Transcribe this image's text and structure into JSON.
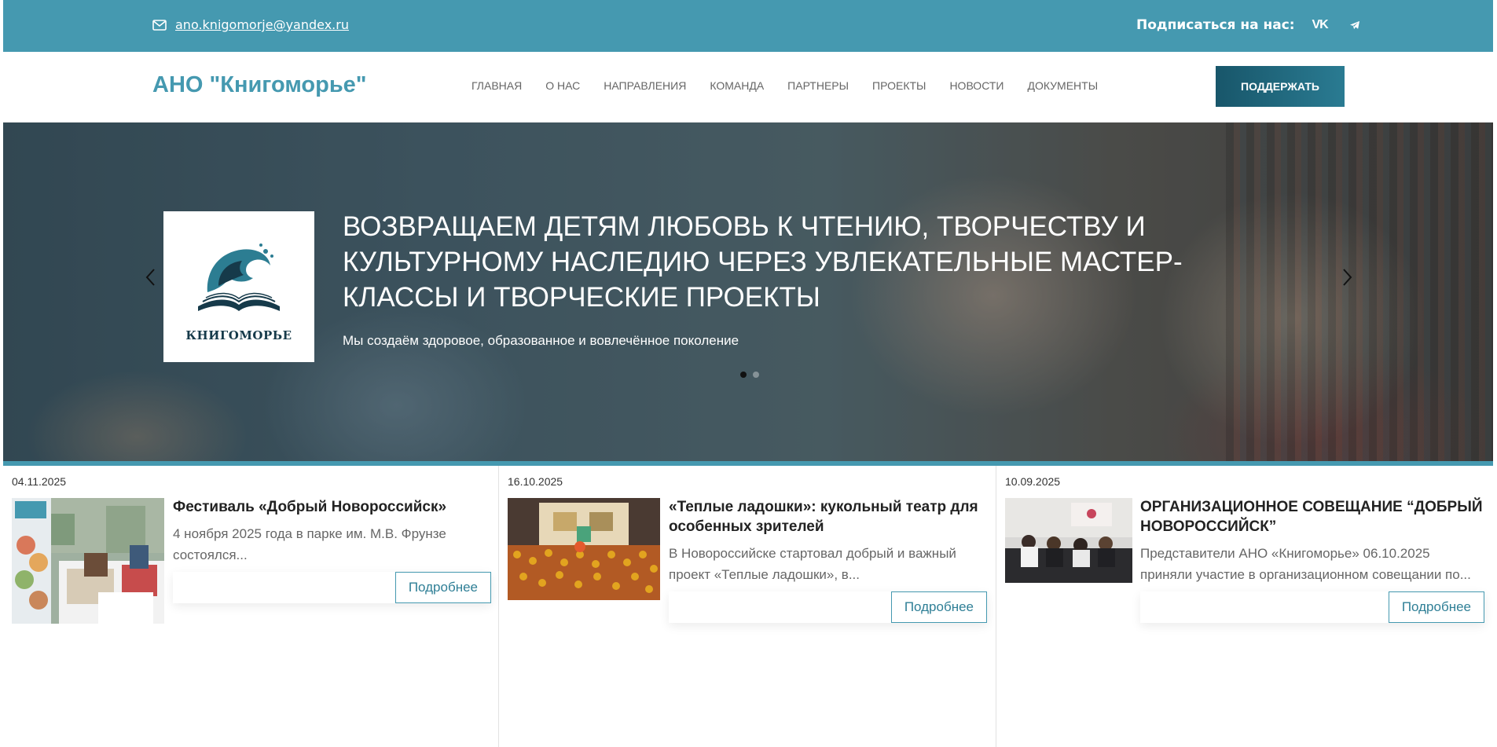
{
  "topbar": {
    "email": "ano.knigomorje@yandex.ru",
    "subscribe_label": "Подписаться на нас:",
    "social": [
      {
        "icon": "vk-icon",
        "text": "VK"
      },
      {
        "icon": "telegram-icon"
      }
    ]
  },
  "header": {
    "logo": "АНО \"Книгоморье\"",
    "nav": [
      "ГЛАВНАЯ",
      "О НАС",
      "НАПРАВЛЕНИЯ",
      "КОМАНДА",
      "ПАРТНЕРЫ",
      "ПРОЕКТЫ",
      "НОВОСТИ",
      "ДОКУМЕНТЫ"
    ],
    "support_button": "ПОДДЕРЖАТЬ"
  },
  "hero": {
    "logo_brand": "КНИГОМОРЬЕ",
    "title": "ВОЗВРАЩАЕМ ДЕТЯМ ЛЮБОВЬ К ЧТЕНИЮ, ТВОРЧЕСТВУ И КУЛЬТУРНОМУ НАСЛЕДИЮ ЧЕРЕЗ УВЛЕКАТЕЛЬНЫЕ МАСТЕР-КЛАССЫ И ТВОРЧЕСКИЕ ПРОЕКТЫ",
    "subtitle": "Мы создаём здоровое, образованное и вовлечённое поколение",
    "slides": 2,
    "active_slide": 1
  },
  "news": [
    {
      "date": "04.11.2025",
      "title": "Фестиваль «Добрый Новороссийск»",
      "excerpt": "4 ноября 2025 года в парке им. М.В. Фрунзе состоялся...",
      "more": "Подробнее"
    },
    {
      "date": "16.10.2025",
      "title": "«Теплые ладошки»: кукольный театр для особенных зрителей",
      "excerpt": "В Новороссийске стартовал добрый и важный проект «Теплые ладошки», в...",
      "more": "Подробнее"
    },
    {
      "date": "10.09.2025",
      "title": "ОРГАНИЗАЦИОННОЕ СОВЕЩАНИЕ “ДОБРЫЙ НОВОРОССИЙСК”",
      "excerpt": "Представители АНО «Книгоморье» 06.10.2025 приняли участие в организационном совещании по...",
      "more": "Подробнее"
    }
  ],
  "colors": {
    "accent": "#4599b0",
    "button_dark": "#1c5c72"
  }
}
